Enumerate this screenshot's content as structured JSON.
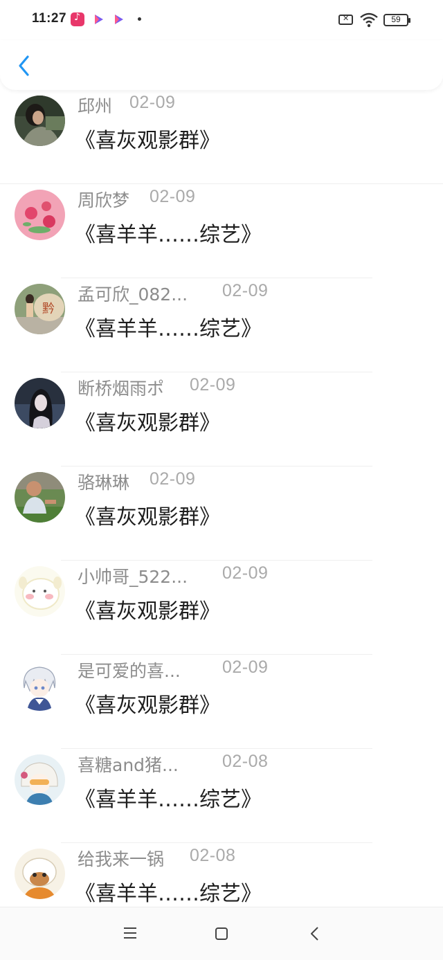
{
  "status_bar": {
    "time": "11:27",
    "battery": "59"
  },
  "header": {
    "back_icon": "chevron-left-icon"
  },
  "accent_color": "#2196F3",
  "items": [
    {
      "name": "邱州",
      "date": "02-09",
      "title": "《喜灰观影群》"
    },
    {
      "name": "周欣梦",
      "date": "02-09",
      "title": "《喜羊羊……综艺》"
    },
    {
      "name": "孟可欣_082...",
      "date": "02-09",
      "title": "《喜羊羊……综艺》"
    },
    {
      "name": "断桥烟雨ポ",
      "date": "02-09",
      "title": "《喜灰观影群》"
    },
    {
      "name": "骆琳琳",
      "date": "02-09",
      "title": "《喜灰观影群》"
    },
    {
      "name": "小帅哥_522...",
      "date": "02-09",
      "title": "《喜灰观影群》"
    },
    {
      "name": "是可爱的喜...",
      "date": "02-09",
      "title": "《喜灰观影群》"
    },
    {
      "name": "喜糖and猪...",
      "date": "02-08",
      "title": "《喜羊羊……综艺》"
    },
    {
      "name": "给我来一锅",
      "date": "02-08",
      "title": "《喜羊羊……综艺》"
    }
  ],
  "navbar": {
    "menu_icon": "menu-icon",
    "home_icon": "home-square-icon",
    "back_icon": "back-triangle-icon"
  }
}
